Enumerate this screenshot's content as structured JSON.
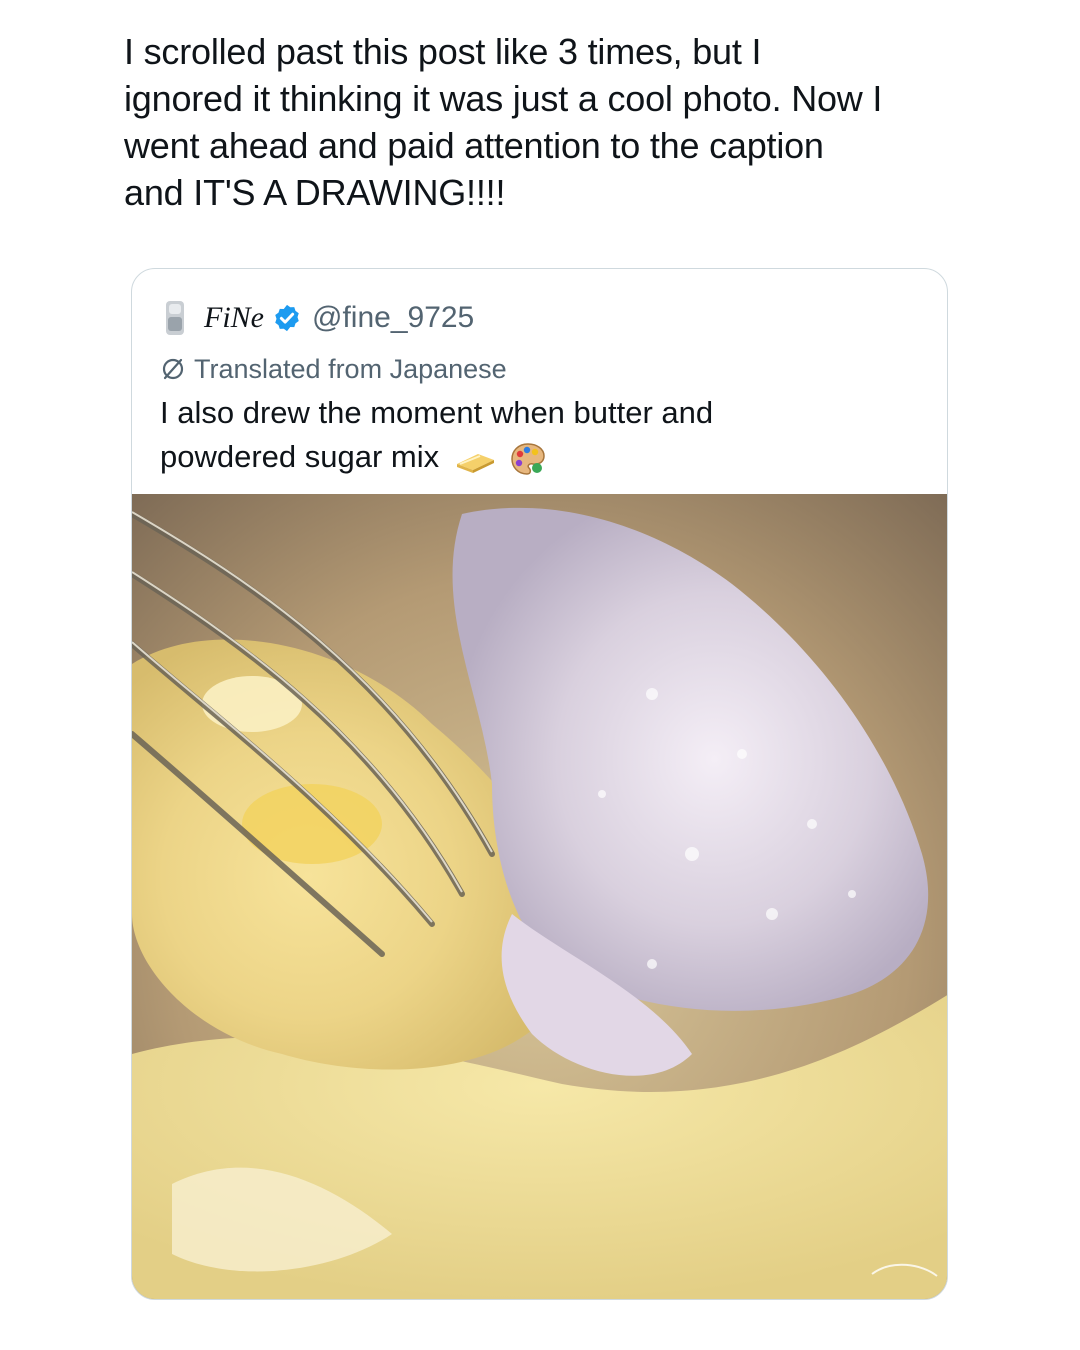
{
  "post": {
    "text_lines": [
      "I scrolled past this post like 3 times, but I",
      "ignored it thinking it was just a cool photo. Now I",
      "went ahead and paid attention to the caption",
      "and IT'S A DRAWING!!!!"
    ]
  },
  "quoted_post": {
    "display_name": "FiNe",
    "handle": "@fine_9725",
    "translation_note": "Translated from Japanese",
    "text_lines": [
      "I also drew the moment when butter and",
      "powdered sugar mix"
    ],
    "emojis": [
      "butter-icon",
      "artist-palette-icon"
    ],
    "verified_color": "#1d9bf0"
  }
}
